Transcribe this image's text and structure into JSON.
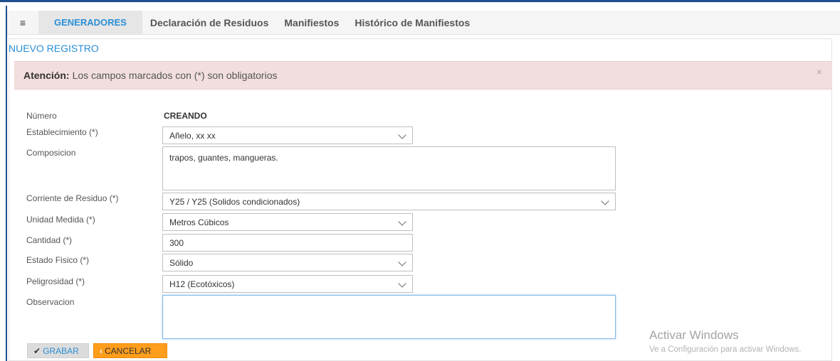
{
  "nav": {
    "menu_icon": "hamburger-icon",
    "tabs": [
      {
        "label": "GENERADORES",
        "active": true
      },
      {
        "label": "Declaración de Residuos",
        "active": false
      },
      {
        "label": "Manifiestos",
        "active": false
      },
      {
        "label": "Histórico de Manifiestos",
        "active": false
      }
    ]
  },
  "panel": {
    "title": "NUEVO REGISTRO"
  },
  "alert": {
    "strong": "Atención:",
    "text": "Los campos marcados con (*) son obligatorios",
    "close": "×"
  },
  "form": {
    "numero": {
      "label": "Número",
      "value": "CREANDO"
    },
    "establecimiento": {
      "label": "Establecimiento (*)",
      "value": "Añelo, xx xx"
    },
    "composicion": {
      "label": "Composicion",
      "value": "trapos, guantes, mangueras."
    },
    "corriente": {
      "label": "Corriente de Residuo (*)",
      "value": "Y25 / Y25 (Solidos condicionados)"
    },
    "unidad": {
      "label": "Unidad Medida (*)",
      "value": "Metros Cúbicos"
    },
    "cantidad": {
      "label": "Cantidad (*)",
      "value": "300"
    },
    "estado": {
      "label": "Estado Fisico (*)",
      "value": "Sólido"
    },
    "peligrosidad": {
      "label": "Peligrosidad (*)",
      "value": "H12 (Ecotóxicos)"
    },
    "observacion": {
      "label": "Observacion",
      "value": ""
    }
  },
  "buttons": {
    "save": "GRABAR",
    "cancel": "CANCELAR"
  },
  "watermark": {
    "title": "Activar Windows",
    "subtitle": "Ve a Configuración para activar Windows."
  },
  "colors": {
    "accent": "#2a8fd6",
    "alert_bg": "#f2dede",
    "cancel_bg": "#ff9d1c",
    "frame": "#1f4e8c"
  }
}
